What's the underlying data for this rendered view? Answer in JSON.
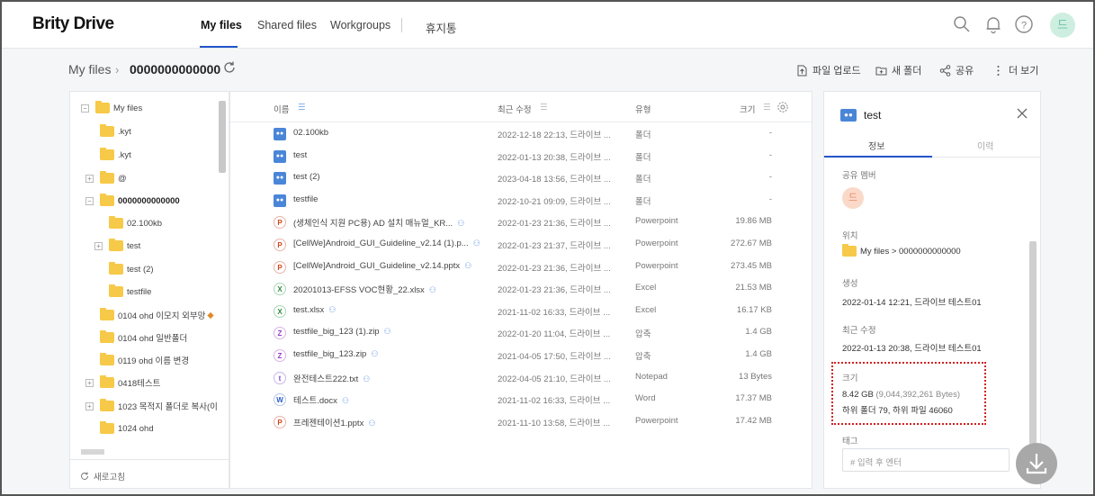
{
  "brand": {
    "logo": "Brity Drive"
  },
  "nav": {
    "tabs": [
      {
        "label": "My files",
        "active": true
      },
      {
        "label": "Shared files",
        "active": false
      },
      {
        "label": "Workgroups",
        "active": false
      },
      {
        "label": "휴지통",
        "active": false
      }
    ],
    "icons": [
      "search-icon",
      "bell-icon",
      "help-icon"
    ],
    "avatar": "드"
  },
  "breadcrumb": {
    "root": "My files",
    "current": "0000000000000"
  },
  "actions": {
    "upload": "파일 업로드",
    "new_folder": "새 폴더",
    "share": "공유",
    "more": "더 보기"
  },
  "tree": {
    "items": [
      {
        "label": "My files",
        "level": 0,
        "expander": "−"
      },
      {
        "label": ".kyt",
        "level": 1
      },
      {
        "label": ".kyt",
        "level": 1
      },
      {
        "label": "@",
        "level": 1,
        "expander": "+"
      },
      {
        "label": "0000000000000",
        "level": 1,
        "expander": "−",
        "bold": true
      },
      {
        "label": "02.100kb",
        "level": 2
      },
      {
        "label": "test",
        "level": 2,
        "expander": "+"
      },
      {
        "label": "test (2)",
        "level": 2
      },
      {
        "label": "testfile",
        "level": 2
      },
      {
        "label": "0104 ohd 이모지 외부망",
        "level": 1
      },
      {
        "label": "0104 ohd 일반폴더",
        "level": 1
      },
      {
        "label": "0119 ohd 이름 변경",
        "level": 1
      },
      {
        "label": "0418테스트",
        "level": 1,
        "expander": "+"
      },
      {
        "label": "1023 목적지 폴더로 복사(이",
        "level": 1,
        "expander": "+"
      },
      {
        "label": "1024 ohd",
        "level": 1
      }
    ],
    "refresh_label": "새로고침"
  },
  "list": {
    "columns": {
      "name": "이름",
      "modified": "최근 수정",
      "type": "유형",
      "size": "크기"
    },
    "rows": [
      {
        "icon": "shared",
        "name": "02.100kb",
        "shared": false,
        "modified": "2022-12-18 22:13, 드라이브 ...",
        "type": "폴더",
        "size": "-"
      },
      {
        "icon": "shared",
        "name": "test",
        "shared": false,
        "modified": "2022-01-13 20:38, 드라이브 ...",
        "type": "폴더",
        "size": "-"
      },
      {
        "icon": "shared",
        "name": "test (2)",
        "shared": false,
        "modified": "2023-04-18 13:56, 드라이브 ...",
        "type": "폴더",
        "size": "-"
      },
      {
        "icon": "shared",
        "name": "testfile",
        "shared": false,
        "modified": "2022-10-21 09:09, 드라이브 ...",
        "type": "폴더",
        "size": "-"
      },
      {
        "icon": "ppt",
        "name": "(생체인식 지원 PC용) AD 설치 매뉴얼_KR...",
        "shared": true,
        "modified": "2022-01-23 21:36, 드라이브 ...",
        "type": "Powerpoint",
        "size": "19.86 MB"
      },
      {
        "icon": "ppt",
        "name": "[CellWe]Android_GUI_Guideline_v2.14 (1).p...",
        "shared": true,
        "modified": "2022-01-23 21:37, 드라이브 ...",
        "type": "Powerpoint",
        "size": "272.67 MB"
      },
      {
        "icon": "ppt",
        "name": "[CellWe]Android_GUI_Guideline_v2.14.pptx",
        "shared": true,
        "modified": "2022-01-23 21:36, 드라이브 ...",
        "type": "Powerpoint",
        "size": "273.45 MB"
      },
      {
        "icon": "xls",
        "name": "20201013-EFSS VOC현황_22.xlsx",
        "shared": true,
        "modified": "2022-01-23 21:36, 드라이브 ...",
        "type": "Excel",
        "size": "21.53 MB"
      },
      {
        "icon": "xls",
        "name": "test.xlsx",
        "shared": true,
        "modified": "2021-11-02 16:33, 드라이브 ...",
        "type": "Excel",
        "size": "16.17 KB"
      },
      {
        "icon": "zip",
        "name": "testfile_big_123 (1).zip",
        "shared": true,
        "modified": "2022-01-20 11:04, 드라이브 ...",
        "type": "압축",
        "size": "1.4 GB"
      },
      {
        "icon": "zip",
        "name": "testfile_big_123.zip",
        "shared": true,
        "modified": "2021-04-05 17:50, 드라이브 ...",
        "type": "압축",
        "size": "1.4 GB"
      },
      {
        "icon": "txt",
        "name": "완전테스트222.txt",
        "shared": true,
        "modified": "2022-04-05 21:10, 드라이브 ...",
        "type": "Notepad",
        "size": "13 Bytes"
      },
      {
        "icon": "doc",
        "name": "테스트.docx",
        "shared": true,
        "modified": "2021-11-02 16:33, 드라이브 ...",
        "type": "Word",
        "size": "17.37 MB"
      },
      {
        "icon": "ppt",
        "name": "프레젠테이션1.pptx",
        "shared": true,
        "modified": "2021-11-10 13:58, 드라이브 ...",
        "type": "Powerpoint",
        "size": "17.42 MB"
      }
    ]
  },
  "info": {
    "title": "test",
    "tabs": [
      "정보",
      "이력"
    ],
    "member_label": "공유 멤버",
    "member_avatar": "드",
    "location_label": "위치",
    "location_value": "My files > 0000000000000",
    "created_label": "생성",
    "created_value": "2022-01-14 12:21, 드라이브 테스트01",
    "modified_label": "최근 수정",
    "modified_value": "2022-01-13 20:38, 드라이브 테스트01",
    "size_label": "크기",
    "size_value": "8.42 GB",
    "size_bytes": "(9,044,392,261 Bytes)",
    "size_detail": "하위 폴더 79, 하위 파일 46060",
    "tag_label": "태그",
    "tag_placeholder": "# 입력 후 엔터"
  },
  "colors": {
    "accent": "#2255c8",
    "folder": "#f7c948",
    "highlight": "#d02020"
  }
}
